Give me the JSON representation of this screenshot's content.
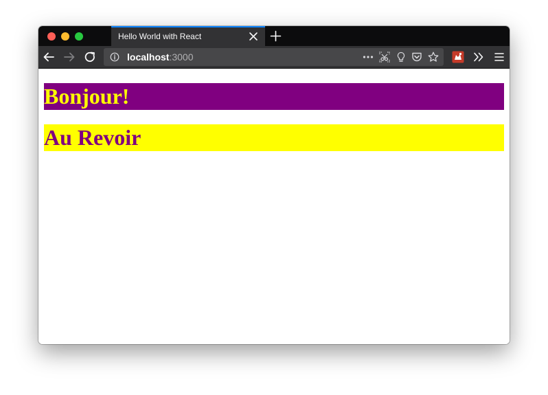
{
  "browser": {
    "tab": {
      "title": "Hello World with React"
    },
    "address": {
      "host": "localhost",
      "port": ":3000"
    }
  },
  "page": {
    "headings": [
      {
        "text": "Bonjour!",
        "color": "#ffff00",
        "background": "#800080"
      },
      {
        "text": "Au Revoir",
        "color": "#800080",
        "background": "#ffff00"
      }
    ]
  },
  "icons": {
    "tabbar": [
      "close-icon",
      "plus-icon"
    ],
    "toolbar": [
      "back-arrow-icon",
      "forward-arrow-icon",
      "reload-icon",
      "info-icon",
      "more-dots-icon",
      "screenshot-icon",
      "lightbulb-icon",
      "pocket-icon",
      "star-icon",
      "extension-icon",
      "overflow-chevron-icon",
      "hamburger-menu-icon"
    ]
  }
}
